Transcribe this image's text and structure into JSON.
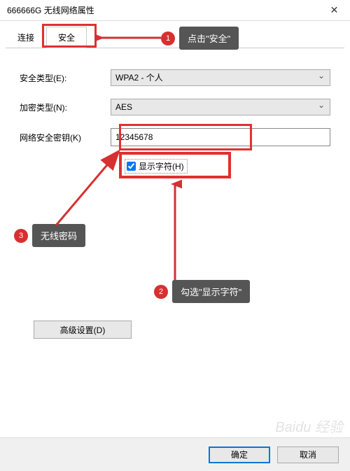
{
  "titlebar": {
    "title": "666666G 无线网络属性"
  },
  "tabs": {
    "connection": "连接",
    "security": "安全"
  },
  "form": {
    "securityTypeLabel": "安全类型(E):",
    "securityTypeValue": "WPA2 - 个人",
    "encryptionTypeLabel": "加密类型(N):",
    "encryptionTypeValue": "AES",
    "networkKeyLabel": "网络安全密钥(K)",
    "networkKeyValue": "12345678",
    "showCharsLabel": "显示字符(H)"
  },
  "advanced": {
    "button": "高级设置(D)"
  },
  "buttons": {
    "ok": "确定",
    "cancel": "取消"
  },
  "annotations": {
    "a1": {
      "num": "1",
      "text": "点击\"安全\""
    },
    "a2": {
      "num": "2",
      "text": "勾选\"显示字符\""
    },
    "a3": {
      "num": "3",
      "text": "无线密码"
    }
  },
  "watermark": "Baidu 经验"
}
